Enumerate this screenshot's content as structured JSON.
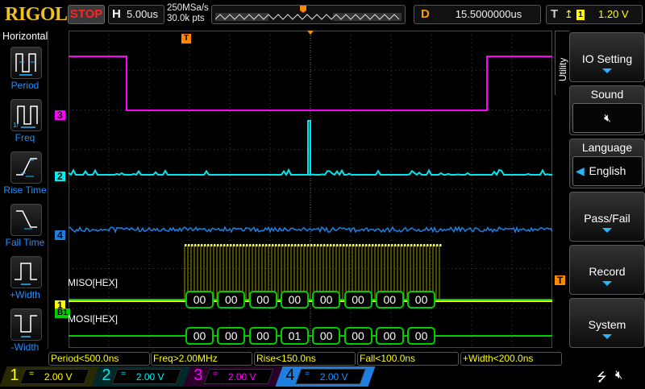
{
  "header": {
    "brand": "RIGOL",
    "run_state": "STOP",
    "horizontal": {
      "key": "H",
      "value": "5.00us"
    },
    "sample_rate": "250MSa/s",
    "memory_depth": "30.0k pts",
    "delay": {
      "key": "D",
      "value": "15.5000000us"
    },
    "trigger": {
      "key": "T",
      "edge": "rising",
      "source": "1",
      "level": "1.20 V"
    }
  },
  "left_menu": {
    "title": "Horizontal",
    "items": [
      {
        "label": "Period",
        "icon": "period-icon"
      },
      {
        "label": "Freq",
        "icon": "frequency-icon"
      },
      {
        "label": "Rise Time",
        "icon": "rise-time-icon"
      },
      {
        "label": "Fall Time",
        "icon": "fall-time-icon"
      },
      {
        "label": "+Width",
        "icon": "positive-width-icon"
      },
      {
        "label": "-Width",
        "icon": "negative-width-icon"
      }
    ]
  },
  "right_menu": {
    "title": "Utility",
    "items": [
      {
        "label": "IO Setting"
      },
      {
        "label": "Sound",
        "value": "muted"
      },
      {
        "label": "Language",
        "value": "English"
      },
      {
        "label": "Pass/Fail"
      },
      {
        "label": "Record"
      },
      {
        "label": "System"
      }
    ]
  },
  "traces": {
    "channel_markers": [
      "3",
      "2",
      "4",
      "1",
      "B1"
    ],
    "trigger_marker": "T",
    "decode": {
      "miso_label": "MISO[HEX]",
      "mosi_label": "MOSI[HEX]",
      "miso": [
        "00",
        "00",
        "00",
        "00",
        "00",
        "00",
        "00",
        "00"
      ],
      "mosi": [
        "00",
        "00",
        "00",
        "01",
        "00",
        "00",
        "00",
        "00"
      ]
    }
  },
  "measurements": [
    "Period<500.0ns",
    "Freq>2.00MHz",
    "Rise<150.0ns",
    "Fall<100.0ns",
    "+Width<200.0ns"
  ],
  "channels": [
    {
      "num": "1",
      "scale": "2.00 V",
      "color": "#ffff00"
    },
    {
      "num": "2",
      "scale": "2.00 V",
      "color": "#00ffff"
    },
    {
      "num": "3",
      "scale": "2.00 V",
      "color": "#ff00ff"
    },
    {
      "num": "4",
      "scale": "2.00 V",
      "color": "#1e90ff",
      "active": true
    }
  ],
  "colors": {
    "ch1": "#ffff00",
    "ch2": "#00e5ee",
    "ch3": "#ff00ff",
    "ch4": "#1e7fe0",
    "bus": "#00cc00",
    "trigger": "#ff8c00"
  }
}
